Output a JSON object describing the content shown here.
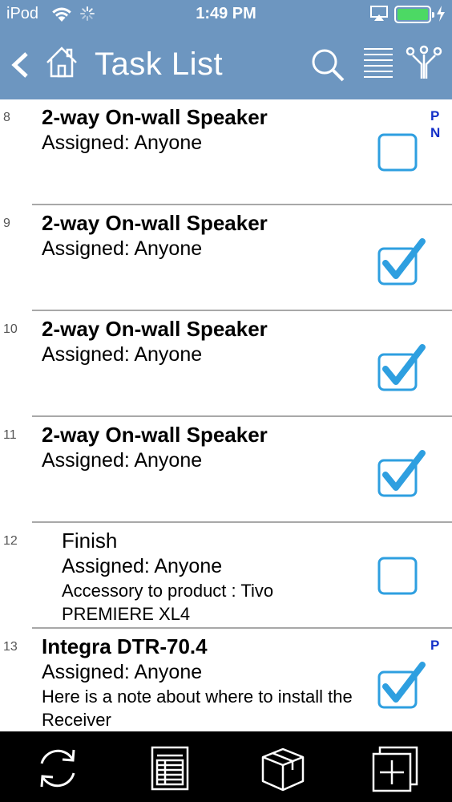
{
  "status_bar": {
    "carrier": "iPod",
    "time": "1:49 PM",
    "battery_color": "#4cd964"
  },
  "nav": {
    "title": "Task List",
    "back_icon": "chevron-left-icon",
    "home_icon": "home-icon",
    "search_icon": "search-icon",
    "list_icon": "list-icon",
    "people_icon": "people-icon",
    "background": "#6d96c0"
  },
  "tasks": [
    {
      "number": "8",
      "name": "2-way On-wall Speaker",
      "assigned": "Assigned: Anyone",
      "note": "",
      "checked": false,
      "flags": [
        "P",
        "N"
      ]
    },
    {
      "number": "9",
      "name": "2-way On-wall Speaker",
      "assigned": "Assigned: Anyone",
      "note": "",
      "checked": true,
      "flags": []
    },
    {
      "number": "10",
      "name": "2-way On-wall Speaker",
      "assigned": "Assigned: Anyone",
      "note": "",
      "checked": true,
      "flags": []
    },
    {
      "number": "11",
      "name": "2-way On-wall Speaker",
      "assigned": "Assigned: Anyone",
      "note": "",
      "checked": true,
      "flags": []
    },
    {
      "number": "12",
      "name": "Finish",
      "assigned": "Assigned: Anyone",
      "note": "Accessory to product : Tivo PREMIERE XL4",
      "checked": false,
      "flags": []
    },
    {
      "number": "13",
      "name": "Integra DTR-70.4",
      "assigned": "Assigned: Anyone",
      "note": "Here is a note about where to install the Receiver",
      "checked": true,
      "flags": [
        "P"
      ]
    }
  ],
  "toolbar": {
    "items": [
      "sync-icon",
      "spreadsheet-icon",
      "box-icon",
      "add-icon"
    ]
  },
  "colors": {
    "checkbox": "#2e9fe0",
    "flag": "#1430c8"
  }
}
